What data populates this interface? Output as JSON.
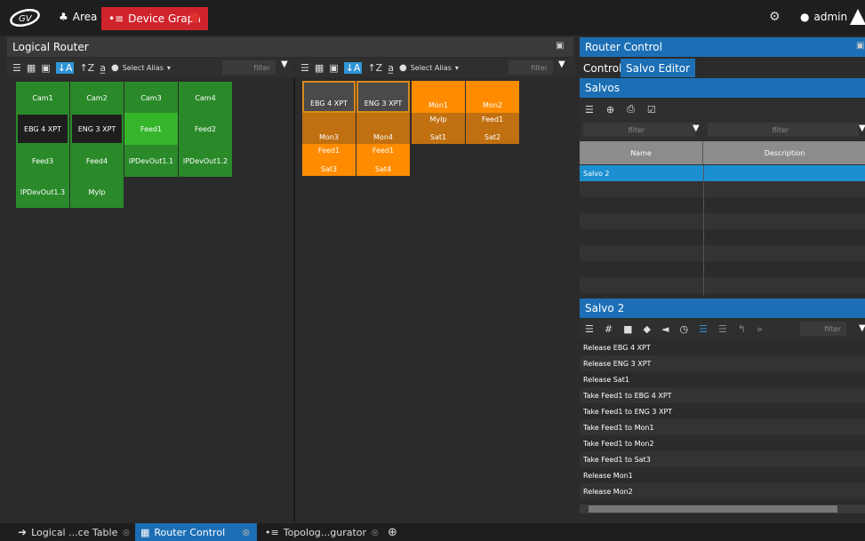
{
  "topbar": {
    "area_label": "Area",
    "device_graph_label": "Device Graph",
    "user_label": "admin"
  },
  "logical_router": {
    "title": "Logical Router",
    "select_alias": "Select Alias",
    "filter_placeholder": "filter",
    "sources": [
      [
        "Cam1",
        "Cam2",
        "Cam3",
        "Cam4"
      ],
      [
        "EBG 4 XPT",
        "ENG 3 XPT",
        "Feed1",
        "Feed2"
      ],
      [
        "Feed3",
        "Feed4",
        "IPDevOut1.1",
        "IPDevOut1.2"
      ],
      [
        "IPDevOut1.3",
        "MyIp"
      ]
    ],
    "destinations": {
      "row1": [
        "EBG 4 XPT",
        "ENG 3 XPT",
        "Mon1",
        "Mon2"
      ],
      "row1_sub": [
        "",
        "",
        "MyIp",
        "Feed1"
      ],
      "row2": [
        "Mon3",
        "Mon4",
        "Sat1",
        "Sat2"
      ],
      "row3_top": [
        "Feed1",
        "Feed1"
      ],
      "row3": [
        "Sat3",
        "Sat4"
      ]
    }
  },
  "router_control": {
    "title": "Router Control",
    "tabs": [
      "Control",
      "Salvo Editor"
    ],
    "salvos_title": "Salvos",
    "filter_placeholder": "filter",
    "col_name": "Name",
    "col_desc": "Description",
    "salvo_rows": [
      "Salvo 2"
    ],
    "salvo2_title": "Salvo 2",
    "salvo2_filter": "filter",
    "salvo2_items": [
      "Release EBG 4 XPT",
      "Release ENG 3 XPT",
      "Release Sat1",
      "Take Feed1 to EBG 4 XPT",
      "Take Feed1 to ENG 3 XPT",
      "Take Feed1 to Mon1",
      "Take Feed1 to Mon2",
      "Take Feed1 to Sat3",
      "Release Mon1",
      "Release Mon2"
    ]
  },
  "bottom_tabs": [
    "Logical ...ce Table",
    "Router Control",
    "Topolog...gurator"
  ],
  "colors": {
    "accent": "#1c6fb5",
    "device_graph": "#d0242d",
    "green": "#2a8a2a",
    "orange": "#ff8c00"
  }
}
